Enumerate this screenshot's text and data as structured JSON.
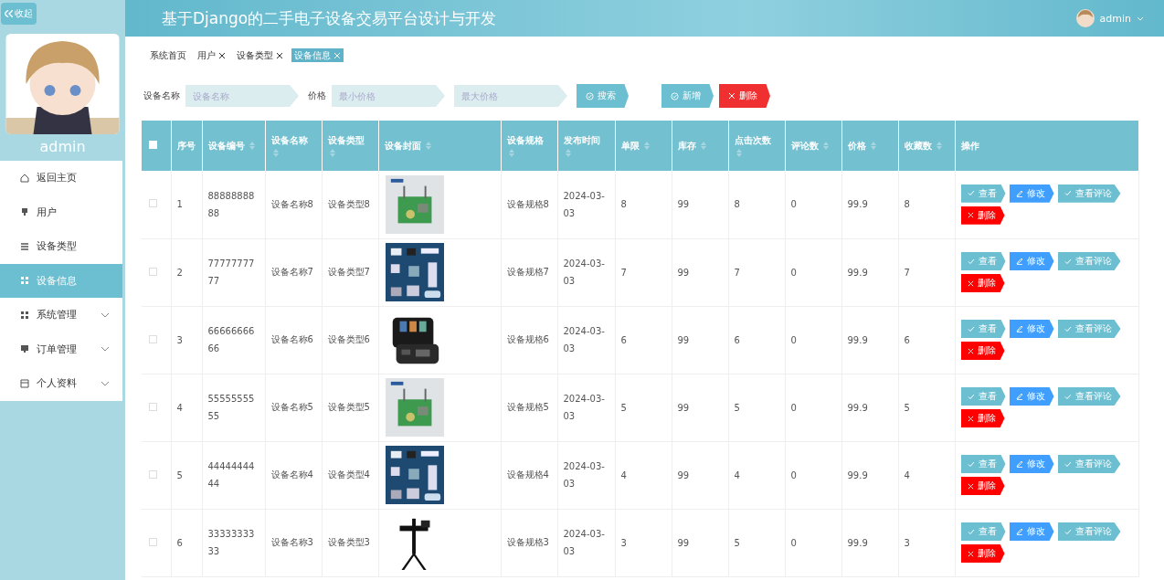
{
  "header": {
    "title": "基于Django的二手电子设备交易平台设计与开发",
    "user": "admin"
  },
  "sidebar": {
    "collapse_label": "收起",
    "profile_name": "admin",
    "items": [
      {
        "label": "返回主页",
        "selected": false,
        "expandable": false
      },
      {
        "label": "用户",
        "selected": false,
        "expandable": false
      },
      {
        "label": "设备类型",
        "selected": false,
        "expandable": false
      },
      {
        "label": "设备信息",
        "selected": true,
        "expandable": false
      },
      {
        "label": "系统管理",
        "selected": false,
        "expandable": true
      },
      {
        "label": "订单管理",
        "selected": false,
        "expandable": true
      },
      {
        "label": "个人资料",
        "selected": false,
        "expandable": true
      }
    ]
  },
  "tabs": [
    {
      "label": "系统首页",
      "closable": false,
      "selected": false
    },
    {
      "label": "用户",
      "closable": true,
      "selected": false
    },
    {
      "label": "设备类型",
      "closable": true,
      "selected": false
    },
    {
      "label": "设备信息",
      "closable": true,
      "selected": true
    }
  ],
  "search": {
    "name_label": "设备名称",
    "name_placeholder": "设备名称",
    "price_label": "价格",
    "min_placeholder": "最小价格",
    "max_placeholder": "最大价格",
    "search_button": "搜索",
    "add_button": "新增",
    "delete_button": "删除"
  },
  "table": {
    "all_checked": false,
    "columns": [
      {
        "label": "序号",
        "sortable": false
      },
      {
        "label": "设备编号",
        "sortable": true
      },
      {
        "label": "设备名称",
        "sortable": true
      },
      {
        "label": "设备类型",
        "sortable": true
      },
      {
        "label": "设备封面",
        "sortable": true
      },
      {
        "label": "设备规格",
        "sortable": true
      },
      {
        "label": "发布时间",
        "sortable": true
      },
      {
        "label": "单限",
        "sortable": true
      },
      {
        "label": "库存",
        "sortable": true
      },
      {
        "label": "点击次数",
        "sortable": true
      },
      {
        "label": "评论数",
        "sortable": true
      },
      {
        "label": "价格",
        "sortable": true
      },
      {
        "label": "收藏数",
        "sortable": true
      },
      {
        "label": "操作",
        "sortable": false
      }
    ],
    "rows": [
      {
        "checked": false,
        "cells": [
          "1",
          "8888888888",
          "设备名称8",
          "设备类型8",
          {
            "kind": "picture"
          },
          "设备规格8",
          "2024-03-03",
          "8",
          "99",
          "8",
          "0",
          "99.9",
          "8"
        ],
        "actions": [
          {
            "label": "查看",
            "kind": "view"
          },
          {
            "label": "修改",
            "kind": "edit"
          },
          {
            "label": "查看评论",
            "kind": "comment"
          },
          {
            "label": "删除",
            "kind": "delete"
          }
        ]
      },
      {
        "checked": false,
        "cells": [
          "2",
          "7777777777",
          "设备名称7",
          "设备类型7",
          {
            "kind": "picture"
          },
          "设备规格7",
          "2024-03-03",
          "7",
          "99",
          "7",
          "0",
          "99.9",
          "7"
        ],
        "actions": [
          {
            "label": "查看",
            "kind": "view"
          },
          {
            "label": "修改",
            "kind": "edit"
          },
          {
            "label": "查看评论",
            "kind": "comment"
          },
          {
            "label": "删除",
            "kind": "delete"
          }
        ]
      },
      {
        "checked": false,
        "cells": [
          "3",
          "6666666666",
          "设备名称6",
          "设备类型6",
          {
            "kind": "picture"
          },
          "设备规格6",
          "2024-03-03",
          "6",
          "99",
          "6",
          "0",
          "99.9",
          "6"
        ],
        "actions": [
          {
            "label": "查看",
            "kind": "view"
          },
          {
            "label": "修改",
            "kind": "edit"
          },
          {
            "label": "查看评论",
            "kind": "comment"
          },
          {
            "label": "删除",
            "kind": "delete"
          }
        ]
      },
      {
        "checked": false,
        "cells": [
          "4",
          "5555555555",
          "设备名称5",
          "设备类型5",
          {
            "kind": "picture"
          },
          "设备规格5",
          "2024-03-03",
          "5",
          "99",
          "5",
          "0",
          "99.9",
          "5"
        ],
        "actions": [
          {
            "label": "查看",
            "kind": "view"
          },
          {
            "label": "修改",
            "kind": "edit"
          },
          {
            "label": "查看评论",
            "kind": "comment"
          },
          {
            "label": "删除",
            "kind": "delete"
          }
        ]
      },
      {
        "checked": false,
        "cells": [
          "5",
          "4444444444",
          "设备名称4",
          "设备类型4",
          {
            "kind": "picture"
          },
          "设备规格4",
          "2024-03-03",
          "4",
          "99",
          "4",
          "0",
          "99.9",
          "4"
        ],
        "actions": [
          {
            "label": "查看",
            "kind": "view"
          },
          {
            "label": "修改",
            "kind": "edit"
          },
          {
            "label": "查看评论",
            "kind": "comment"
          },
          {
            "label": "删除",
            "kind": "delete"
          }
        ]
      },
      {
        "checked": false,
        "cells": [
          "6",
          "3333333333",
          "设备名称3",
          "设备类型3",
          {
            "kind": "picture"
          },
          "设备规格3",
          "2024-03-03",
          "3",
          "99",
          "5",
          "0",
          "99.9",
          "3"
        ],
        "actions": [
          {
            "label": "查看",
            "kind": "view"
          },
          {
            "label": "修改",
            "kind": "edit"
          },
          {
            "label": "查看评论",
            "kind": "comment"
          },
          {
            "label": "删除",
            "kind": "delete"
          }
        ]
      }
    ]
  }
}
